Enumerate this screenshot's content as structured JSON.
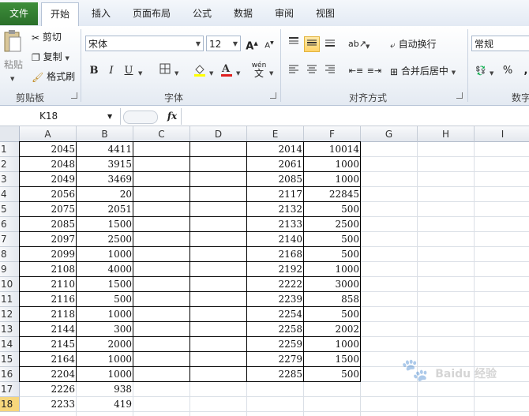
{
  "ribbon_tabs": {
    "file": "文件",
    "tabs": [
      "开始",
      "插入",
      "页面布局",
      "公式",
      "数据",
      "审阅",
      "视图"
    ]
  },
  "clipboard": {
    "paste": "粘贴",
    "cut": "剪切",
    "copy": "复制",
    "format_painter": "格式刷",
    "group": "剪贴板"
  },
  "font": {
    "name": "宋体",
    "size": "12",
    "group": "字体",
    "bold": "B",
    "italic": "I",
    "underline": "U",
    "grow": "A",
    "shrink": "A",
    "phonetic": "wén"
  },
  "alignment": {
    "wrap": "自动换行",
    "merge": "合并后居中",
    "group": "对齐方式"
  },
  "number": {
    "format": "常规",
    "percent": "%",
    "group": "数字"
  },
  "formula_bar": {
    "name_box": "K18",
    "fx": "fx",
    "content": ""
  },
  "colors": {
    "file_tab": "#2a6f2a",
    "highlight": "#ffd36a",
    "font_color": "#e02020",
    "fill_color": "#ffff00",
    "selected_row": "#f7d77c"
  },
  "columns": [
    "A",
    "B",
    "C",
    "D",
    "E",
    "F",
    "G",
    "H",
    "I"
  ],
  "rows": [
    "1",
    "2",
    "3",
    "4",
    "5",
    "6",
    "7",
    "8",
    "9",
    "10",
    "11",
    "12",
    "13",
    "14",
    "15",
    "16",
    "17",
    "18"
  ],
  "selected_row": "18",
  "colA": [
    "2045",
    "2048",
    "2049",
    "2056",
    "2075",
    "2085",
    "2097",
    "2099",
    "2108",
    "2110",
    "2116",
    "2118",
    "2144",
    "2145",
    "2164",
    "2204",
    "2226",
    "2233"
  ],
  "colB": [
    "4411",
    "3915",
    "3469",
    "20",
    "2051",
    "1500",
    "2500",
    "1000",
    "4000",
    "1500",
    "500",
    "1000",
    "300",
    "2000",
    "1000",
    "1000",
    "938",
    "419"
  ],
  "colE": [
    "2014",
    "2061",
    "2085",
    "2117",
    "2132",
    "2133",
    "2140",
    "2168",
    "2192",
    "2222",
    "2239",
    "2254",
    "2258",
    "2259",
    "2279",
    "2285"
  ],
  "colF": [
    "10014",
    "1000",
    "1000",
    "22845",
    "500",
    "2500",
    "500",
    "500",
    "1000",
    "3000",
    "858",
    "500",
    "2002",
    "1000",
    "1500",
    "500"
  ],
  "watermark": "Baidu 经验"
}
